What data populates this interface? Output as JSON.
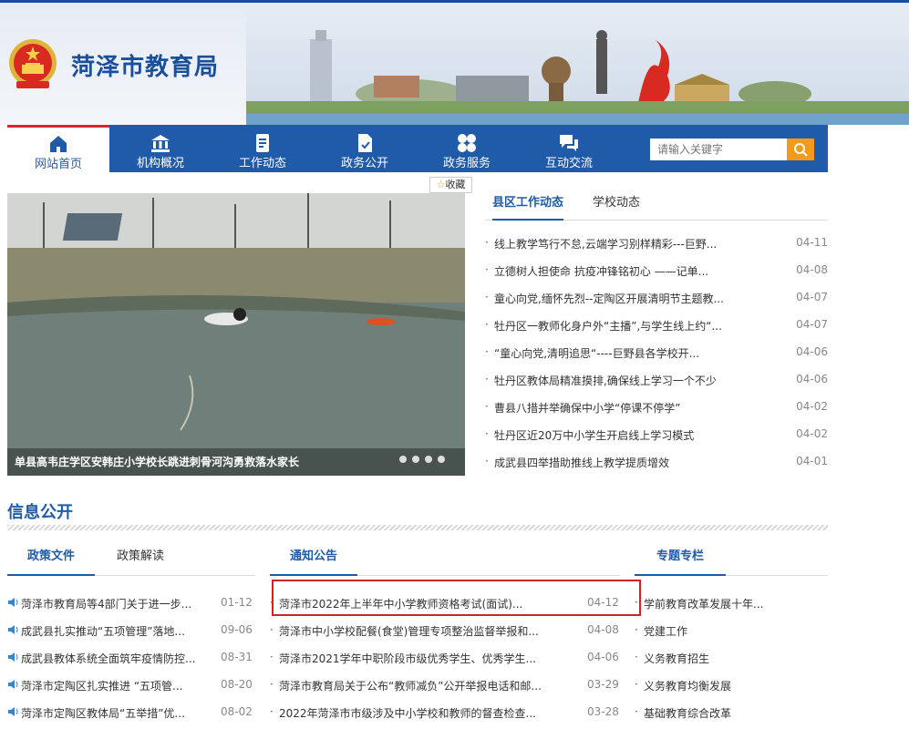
{
  "site": {
    "title": "菏泽市教育局"
  },
  "nav": [
    {
      "label": "网站首页",
      "icon": "home-icon"
    },
    {
      "label": "机构概况",
      "icon": "institution-icon"
    },
    {
      "label": "工作动态",
      "icon": "document-icon"
    },
    {
      "label": "政务公开",
      "icon": "file-check-icon"
    },
    {
      "label": "政务服务",
      "icon": "grid-icon"
    },
    {
      "label": "互动交流",
      "icon": "chat-icon"
    }
  ],
  "search": {
    "placeholder": "请输入关键字"
  },
  "bookmark": {
    "label": "收藏"
  },
  "slider": {
    "caption": "单县高韦庄学区安韩庄小学校长跳进刺骨河沟勇救落水家长"
  },
  "news_tabs": [
    "县区工作动态",
    "学校动态"
  ],
  "news": [
    {
      "title": "线上教学笃行不怠,云端学习别样精彩---巨野...",
      "date": "04-11"
    },
    {
      "title": "立德树人担使命 抗疫冲锋铭初心 ——记单...",
      "date": "04-08"
    },
    {
      "title": "童心向党,缅怀先烈--定陶区开展清明节主题教...",
      "date": "04-07"
    },
    {
      "title": "牡丹区一教师化身户外“主播”,与学生线上约“...",
      "date": "04-07"
    },
    {
      "title": "“童心向党,清明追思“----巨野县各学校开...",
      "date": "04-06"
    },
    {
      "title": "牡丹区教体局精准摸排,确保线上学习一个不少",
      "date": "04-06"
    },
    {
      "title": "曹县八措并举确保中小学“停课不停学”",
      "date": "04-02"
    },
    {
      "title": "牡丹区近20万中小学生开启线上学习模式",
      "date": "04-02"
    },
    {
      "title": "成武县四举措助推线上教学提质增效",
      "date": "04-01"
    }
  ],
  "info_section": {
    "title": "信息公开"
  },
  "policy_tabs": [
    "政策文件",
    "政策解读"
  ],
  "policy": [
    {
      "title": "菏泽市教育局等4部门关于进一步...",
      "date": "01-12"
    },
    {
      "title": "成武县扎实推动“五项管理”落地...",
      "date": "09-06"
    },
    {
      "title": "成武县教体系统全面筑牢疫情防控...",
      "date": "08-31"
    },
    {
      "title": "菏泽市定陶区扎实推进 “五项管...",
      "date": "08-20"
    },
    {
      "title": "菏泽市定陶区教体局“五举措”优...",
      "date": "08-02"
    }
  ],
  "notice_tab": "通知公告",
  "notices": [
    {
      "title": "菏泽市2022年上半年中小学教师资格考试(面试)...",
      "date": "04-12"
    },
    {
      "title": "菏泽市中小学校配餐(食堂)管理专项整治监督举报和...",
      "date": "04-08"
    },
    {
      "title": "菏泽市2021学年中职阶段市级优秀学生、优秀学生...",
      "date": "04-06"
    },
    {
      "title": "菏泽市教育局关于公布“教师减负”公开举报电话和邮...",
      "date": "03-29"
    },
    {
      "title": "2022年菏泽市市级涉及中小学校和教师的督查检查...",
      "date": "03-28"
    }
  ],
  "special_tab": "专题专栏",
  "specials": [
    "学前教育改革发展十年...",
    "党建工作",
    "义务教育招生",
    "义务教育均衡发展",
    "基础教育综合改革"
  ],
  "colors": {
    "brand": "#1f5ba8",
    "accent": "#f29b1a",
    "highlight": "#d31f26"
  }
}
